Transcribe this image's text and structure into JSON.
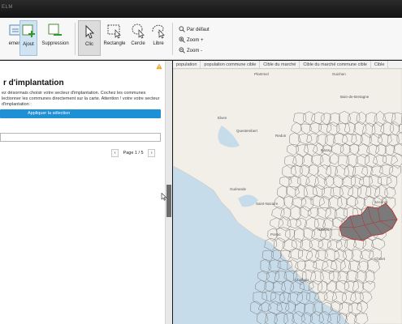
{
  "window": {
    "title": "ELM"
  },
  "ribbon": {
    "buttons": [
      {
        "label": "ement"
      },
      {
        "label": "Ajout"
      },
      {
        "label": "Suppression"
      },
      {
        "label": "Clic"
      },
      {
        "label": "Rectangle"
      },
      {
        "label": "Cercle"
      },
      {
        "label": "Libre"
      }
    ],
    "zoom": [
      {
        "label": "Par défaut"
      },
      {
        "label": "Zoom +"
      },
      {
        "label": "Zoom -"
      }
    ]
  },
  "panel": {
    "title": "r d'implantation",
    "description": "ez désormais choisir votre secteur d'implantation. Cochez les communes lectionner les communes directement sur la carte. Attention ! votre votre secteur d'implantation :",
    "apply_label": "Appliquer la sélection",
    "input_value": "",
    "pager": {
      "prev": "‹",
      "text": "Page 1 / 5",
      "next": "›"
    }
  },
  "map": {
    "tabs": [
      "population",
      "population commune cible",
      "Cible du marché",
      "Cible du marché commune cible",
      "Cible"
    ],
    "places": [
      "Ploërmel",
      "Guichen",
      "Elven",
      "Bain-de-Bretagne",
      "Questembert",
      "Redon",
      "Nozay",
      "Guérande",
      "Ancenis",
      "Saint-Nazaire",
      "Nantes",
      "Pornic",
      "Challans",
      "Cholet"
    ],
    "colors": {
      "selection_fill": "#7a7a7a",
      "selection_border": "#c0282e",
      "sea": "#c7dcea",
      "land": "#f2efe8",
      "border": "#7a7a7a"
    }
  }
}
